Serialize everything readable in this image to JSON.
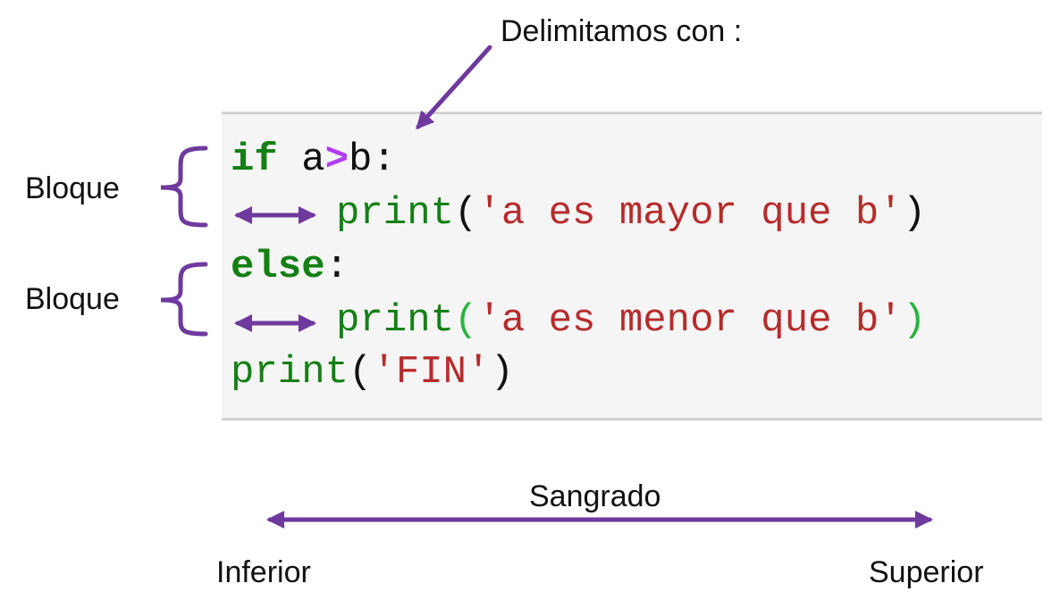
{
  "annotations": {
    "delimiter_note": "Delimitamos con :",
    "block_label_1": "Bloque",
    "block_label_2": "Bloque",
    "indent_title": "Sangrado",
    "indent_low": "Inferior",
    "indent_high": "Superior"
  },
  "code": {
    "line1": {
      "kw": "if",
      "sp": " ",
      "a": "a",
      "op": ">",
      "b": "b",
      "colon": ":"
    },
    "line2": {
      "fn": "print",
      "open": "(",
      "str": "'a es mayor que b'",
      "close": ")"
    },
    "line3": {
      "kw": "else",
      "colon": ":"
    },
    "line4": {
      "fn": "print",
      "open": "(",
      "str": "'a es menor que b'",
      "close": ")"
    },
    "line5": {
      "fn": "print",
      "open": "(",
      "str": "'FIN'",
      "close": ")"
    }
  },
  "colors": {
    "annotation_purple": "#6e3a9e",
    "keyword_green": "#148014",
    "string_red": "#b82b2b",
    "operator_violet": "#b13cf0",
    "code_background": "#f5f5f5"
  }
}
